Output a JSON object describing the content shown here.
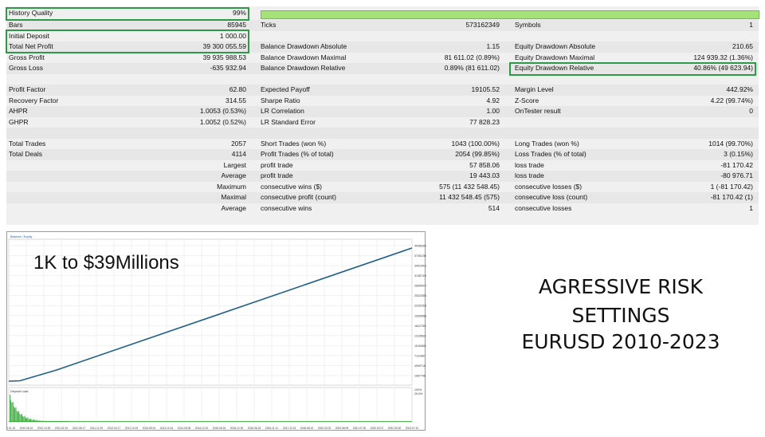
{
  "report": {
    "history_quality": {
      "label": "History Quality",
      "value": "99%"
    },
    "rows": [
      [
        {
          "t": "Bars"
        },
        {
          "t": "85945"
        },
        {
          "t": "Ticks"
        },
        {
          "t": "573162349"
        },
        {
          "t": "Symbols"
        },
        {
          "t": "1"
        }
      ],
      [
        {
          "t": "Initial Deposit"
        },
        {
          "t": "1 000.00"
        },
        {
          "t": ""
        },
        {
          "t": ""
        },
        {
          "t": ""
        },
        {
          "t": ""
        }
      ],
      [
        {
          "t": "Total Net Profit"
        },
        {
          "t": "39 300 055.59"
        },
        {
          "t": "Balance Drawdown Absolute"
        },
        {
          "t": "1.15"
        },
        {
          "t": "Equity Drawdown Absolute"
        },
        {
          "t": "210.65"
        }
      ],
      [
        {
          "t": "Gross Profit"
        },
        {
          "t": "39 935 988.53"
        },
        {
          "t": "Balance Drawdown Maximal"
        },
        {
          "t": "81 611.02 (0.89%)"
        },
        {
          "t": "Equity Drawdown Maximal"
        },
        {
          "t": "124 939.32 (1.36%)"
        }
      ],
      [
        {
          "t": "Gross Loss"
        },
        {
          "t": "-635 932.94"
        },
        {
          "t": "Balance Drawdown Relative"
        },
        {
          "t": "0.89% (81 611.02)"
        },
        {
          "t": "Equity Drawdown Relative"
        },
        {
          "t": "40.86% (49 623.94)"
        }
      ],
      [
        {
          "t": ""
        },
        {
          "t": ""
        },
        {
          "t": ""
        },
        {
          "t": ""
        },
        {
          "t": ""
        },
        {
          "t": ""
        }
      ],
      [
        {
          "t": "Profit Factor"
        },
        {
          "t": "62.80"
        },
        {
          "t": "Expected Payoff"
        },
        {
          "t": "19105.52"
        },
        {
          "t": "Margin Level"
        },
        {
          "t": "442.92%"
        }
      ],
      [
        {
          "t": "Recovery Factor"
        },
        {
          "t": "314.55"
        },
        {
          "t": "Sharpe Ratio"
        },
        {
          "t": "4.92"
        },
        {
          "t": "Z-Score"
        },
        {
          "t": "4.22 (99.74%)"
        }
      ],
      [
        {
          "t": "AHPR"
        },
        {
          "t": "1.0053 (0.53%)"
        },
        {
          "t": "LR Correlation"
        },
        {
          "t": "1.00"
        },
        {
          "t": "OnTester result"
        },
        {
          "t": "0"
        }
      ],
      [
        {
          "t": "GHPR"
        },
        {
          "t": "1.0052 (0.52%)"
        },
        {
          "t": "LR Standard Error"
        },
        {
          "t": "77 828.23"
        },
        {
          "t": ""
        },
        {
          "t": ""
        }
      ],
      [
        {
          "t": ""
        },
        {
          "t": ""
        },
        {
          "t": ""
        },
        {
          "t": ""
        },
        {
          "t": ""
        },
        {
          "t": ""
        }
      ],
      [
        {
          "t": "Total Trades"
        },
        {
          "t": "2057"
        },
        {
          "t": "Short Trades (won %)"
        },
        {
          "t": "1043 (100.00%)"
        },
        {
          "t": "Long Trades (won %)"
        },
        {
          "t": "1014 (99.70%)"
        }
      ],
      [
        {
          "t": "Total Deals"
        },
        {
          "t": "4114"
        },
        {
          "t": "Profit Trades (% of total)"
        },
        {
          "t": "2054 (99.85%)"
        },
        {
          "t": "Loss Trades (% of total)"
        },
        {
          "t": "3 (0.15%)"
        }
      ],
      [
        {
          "t": ""
        },
        {
          "t": "Largest"
        },
        {
          "t": "profit trade"
        },
        {
          "t": "57 858.06"
        },
        {
          "t": "loss trade"
        },
        {
          "t": "-81 170.42"
        }
      ],
      [
        {
          "t": ""
        },
        {
          "t": "Average"
        },
        {
          "t": "profit trade"
        },
        {
          "t": "19 443.03"
        },
        {
          "t": "loss trade"
        },
        {
          "t": "-80 976.71"
        }
      ],
      [
        {
          "t": ""
        },
        {
          "t": "Maximum"
        },
        {
          "t": "consecutive wins ($)"
        },
        {
          "t": "575 (11 432 548.45)"
        },
        {
          "t": "consecutive losses ($)"
        },
        {
          "t": "1 (-81 170.42)"
        }
      ],
      [
        {
          "t": ""
        },
        {
          "t": "Maximal"
        },
        {
          "t": "consecutive profit (count)"
        },
        {
          "t": "11 432 548.45 (575)"
        },
        {
          "t": "consecutive loss (count)"
        },
        {
          "t": "-81 170.42 (1)"
        }
      ],
      [
        {
          "t": ""
        },
        {
          "t": "Average"
        },
        {
          "t": "consecutive wins"
        },
        {
          "t": "514"
        },
        {
          "t": "consecutive losses"
        },
        {
          "t": "1"
        }
      ]
    ]
  },
  "chart": {
    "legend": "Balance / Equity",
    "deposit_label": "Deposit Load",
    "y_ticks": [
      "40483309",
      "37451289",
      "34419419",
      "31387449",
      "28355479",
      "25323508",
      "22291538",
      "19259568",
      "16227597",
      "13195627",
      "10163657",
      "7131687",
      "4099716",
      "1067746"
    ],
    "deposit_ticks": [
      "100%",
      "25.0%"
    ],
    "x_ticks": [
      "2010.01.19",
      "2010.06.10",
      "2010.10.26",
      "2011.02.15",
      "2011.06.17",
      "2011.11.09",
      "2012.04.17",
      "2012.10.19",
      "2013.05.01",
      "2013.10.24",
      "2014.06.06",
      "2014.12.10",
      "2015.06.16",
      "2015.12.29",
      "2016.06.23",
      "2016.11.11",
      "2017.11.03",
      "2018.08.10",
      "2020.03.02",
      "2020.08.09",
      "2021.07.20",
      "2022.03.07",
      "2022.09.30",
      "2023.07.10"
    ],
    "line_color": "#1f5f8b",
    "deposit_color": "#2fa52f"
  },
  "overlay": {
    "text": "1K to $39Millions"
  },
  "right_titles": [
    "AGRESSIVE RISK",
    "SETTINGS",
    "EURUSD 2010-2023"
  ]
}
